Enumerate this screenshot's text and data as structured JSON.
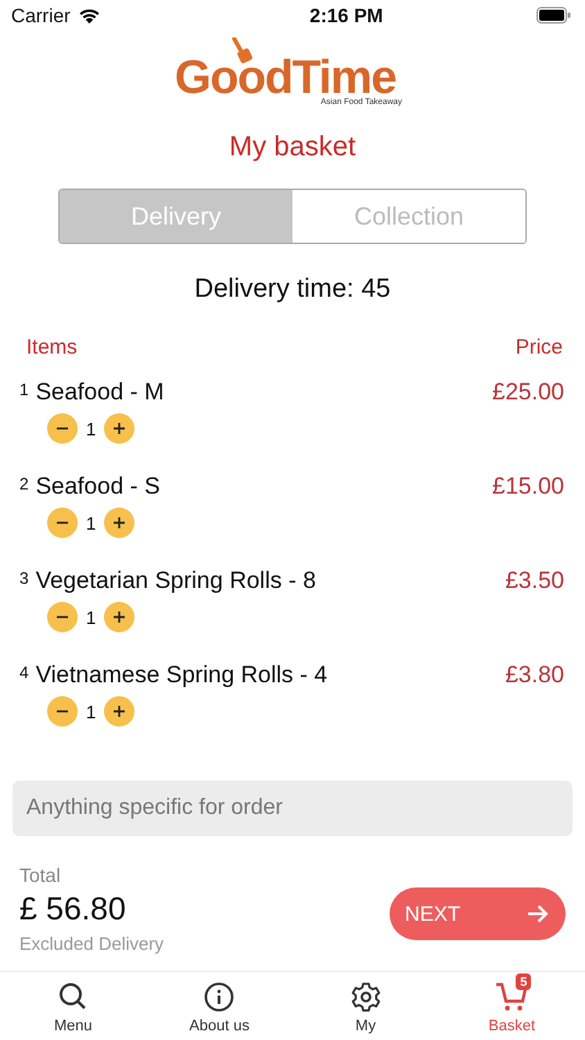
{
  "status_bar": {
    "carrier": "Carrier",
    "time": "2:16 PM"
  },
  "logo": {
    "name": "GoodTime",
    "tagline": "Asian Food Takeaway"
  },
  "title": "My basket",
  "tabs": [
    {
      "label": "Delivery",
      "selected": true
    },
    {
      "label": "Collection",
      "selected": false
    }
  ],
  "delivery_time": "Delivery time: 45",
  "columns": {
    "items": "Items",
    "price": "Price"
  },
  "items": [
    {
      "index": "1",
      "name": "Seafood - M",
      "quantity": "1",
      "price": "£25.00"
    },
    {
      "index": "2",
      "name": "Seafood - S",
      "quantity": "1",
      "price": "£15.00"
    },
    {
      "index": "3",
      "name": "Vegetarian Spring Rolls - 8",
      "quantity": "1",
      "price": "£3.50"
    },
    {
      "index": "4",
      "name": "Vietnamese Spring Rolls - 4",
      "quantity": "1",
      "price": "£3.80"
    }
  ],
  "note": {
    "placeholder": "Anything specific for order"
  },
  "total": {
    "label": "Total",
    "amount": "£ 56.80",
    "note": "Excluded Delivery"
  },
  "next_button": "NEXT",
  "nav": [
    {
      "label": "Menu",
      "selected": false
    },
    {
      "label": "About us",
      "selected": false
    },
    {
      "label": "My",
      "selected": false
    },
    {
      "label": "Basket",
      "selected": true,
      "badge": "5"
    }
  ]
}
